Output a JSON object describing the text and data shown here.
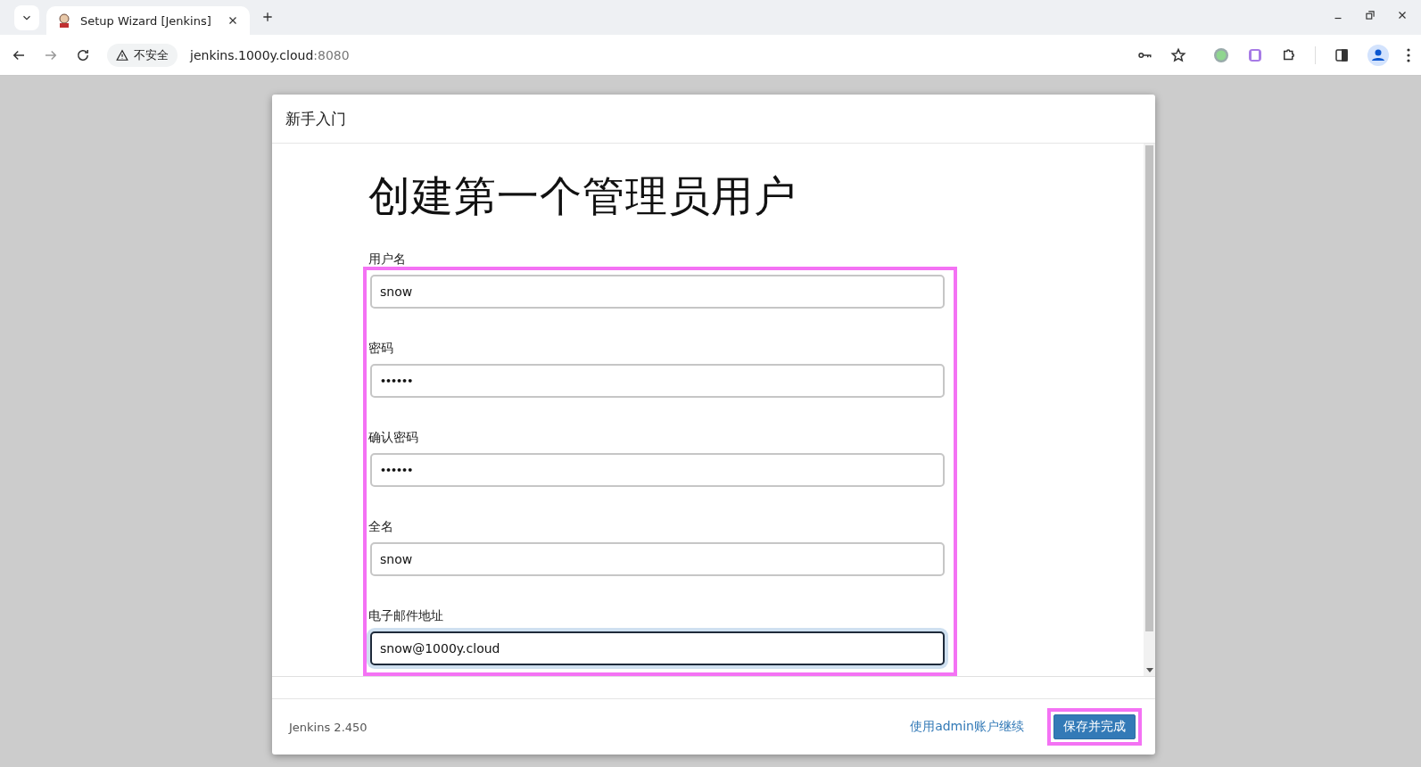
{
  "browser": {
    "tab": {
      "title": "Setup Wizard [Jenkins]",
      "selected": true
    },
    "security_label": "不安全",
    "url_host": "jenkins.1000y.cloud",
    "url_port": ":8080"
  },
  "dialog": {
    "header": "新手入门",
    "heading": "创建第一个管理员用户",
    "fields": [
      {
        "label": "用户名",
        "value": "snow",
        "kind": "text",
        "focused": false
      },
      {
        "label": "密码",
        "value": "••••••",
        "kind": "password",
        "focused": false
      },
      {
        "label": "确认密码",
        "value": "••••••",
        "kind": "password",
        "focused": false
      },
      {
        "label": "全名",
        "value": "snow",
        "kind": "text",
        "focused": false
      },
      {
        "label": "电子邮件地址",
        "value": "snow@1000y.cloud",
        "kind": "text",
        "focused": true
      }
    ],
    "version": "Jenkins 2.450",
    "skip_link": "使用admin账户继续",
    "save_button": "保存并完成"
  }
}
